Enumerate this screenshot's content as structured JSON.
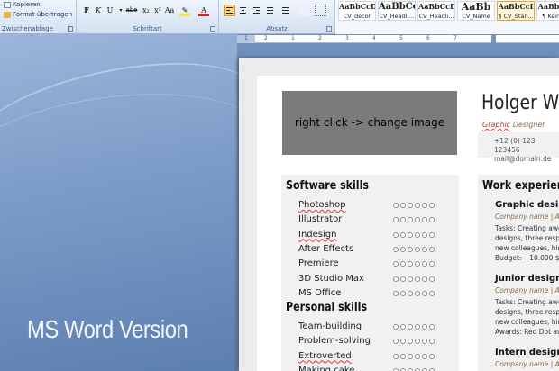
{
  "ribbon": {
    "clipboard": {
      "copy_label": "Kopieren",
      "format_painter_label": "Format übertragen",
      "group_label": "Zwischenablage"
    },
    "font": {
      "group_label": "Schriftart",
      "bold": "F",
      "italic": "K",
      "underline": "U",
      "strike": "abe",
      "subscript": "x₂",
      "superscript": "x²",
      "change_case": "Aa",
      "font_color": "A"
    },
    "paragraph": {
      "group_label": "Absatz"
    },
    "styles": [
      {
        "preview": "AaBbCcD",
        "name": "CV_decor"
      },
      {
        "preview": "AaBbCc",
        "name": "CV_Headli..."
      },
      {
        "preview": "AaBbCcD",
        "name": "CV_Headli..."
      },
      {
        "preview": "AaBb",
        "name": "CV_Name"
      },
      {
        "preview": "AaBbCcI",
        "name": "¶ CV_Stan...",
        "selected": true
      },
      {
        "preview": "AaBbCcI",
        "name": "¶ Kein Le"
      }
    ]
  },
  "ruler": {
    "numbers": [
      "1",
      "2",
      "1",
      "2",
      "3",
      "4",
      "5",
      "6",
      "7"
    ]
  },
  "background": {
    "version_label": "MS Word Version"
  },
  "document": {
    "image_placeholder": "right click -> change image",
    "name": "Holger Wu",
    "role": {
      "part1": "Graphic",
      "part2": " Designer"
    },
    "contact": {
      "phone": "+12 (0) 123 123456",
      "email": "mail@domain.de"
    },
    "software_title": "Software skills",
    "software_skills": [
      "Photoshop",
      "Illustrator",
      "Indesign",
      "After Effects",
      "Premiere",
      "3D Studio Max",
      "MS Office"
    ],
    "personal_title": "Personal skills",
    "personal_skills": [
      "Team-building",
      "Problem-solving",
      "Extroverted",
      "Making cake"
    ],
    "work_title": "Work experience",
    "jobs": [
      {
        "title": "Graphic designer",
        "company": "Company name | Au",
        "lines": [
          "Tasks: Creating awes",
          "designs, three respon",
          "new colleagues, hired",
          "Budget: ~10.000 $"
        ]
      },
      {
        "title": "Junior designer",
        "company": "Company name | Au",
        "lines": [
          "Tasks: Creating awes",
          "designs, three respon",
          "new colleagues, hired",
          "Awards: Red Dot award"
        ]
      },
      {
        "title": "Intern designer",
        "company": "Company name | Au",
        "lines": []
      }
    ],
    "rating_scale": 6
  }
}
